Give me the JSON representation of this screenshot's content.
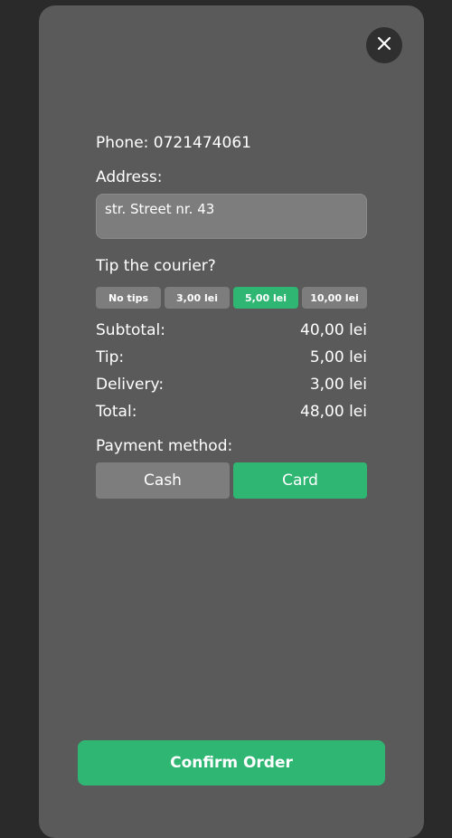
{
  "order": {
    "phone": "Phone: 0721474061",
    "address_label": "Address:",
    "address_value": "str. Street nr. 43",
    "tip_label": "Tip the courier?",
    "tips": [
      "No tips",
      "3,00 lei",
      "5,00 lei",
      "10,00 lei"
    ],
    "selected_tip": "5,00 lei",
    "summary": {
      "subtotal_label": "Subtotal:",
      "subtotal_value": "40,00 lei",
      "tip_label": "Tip:",
      "tip_value": "5,00 lei",
      "delivery_label": "Delivery:",
      "delivery_value": "3,00 lei",
      "total_label": "Total:",
      "total_value": "48,00 lei"
    },
    "payment_label": "Payment method:",
    "payment_options": [
      "Cash",
      "Card"
    ],
    "selected_payment": "Card",
    "confirm_label": "Confirm Order"
  },
  "icons": {
    "close": "close-icon"
  },
  "colors": {
    "accent": "#2fb673",
    "modal_bg": "#5a5a5a",
    "page_bg": "#2a2a2a",
    "button_gray": "#7d7d7d"
  }
}
